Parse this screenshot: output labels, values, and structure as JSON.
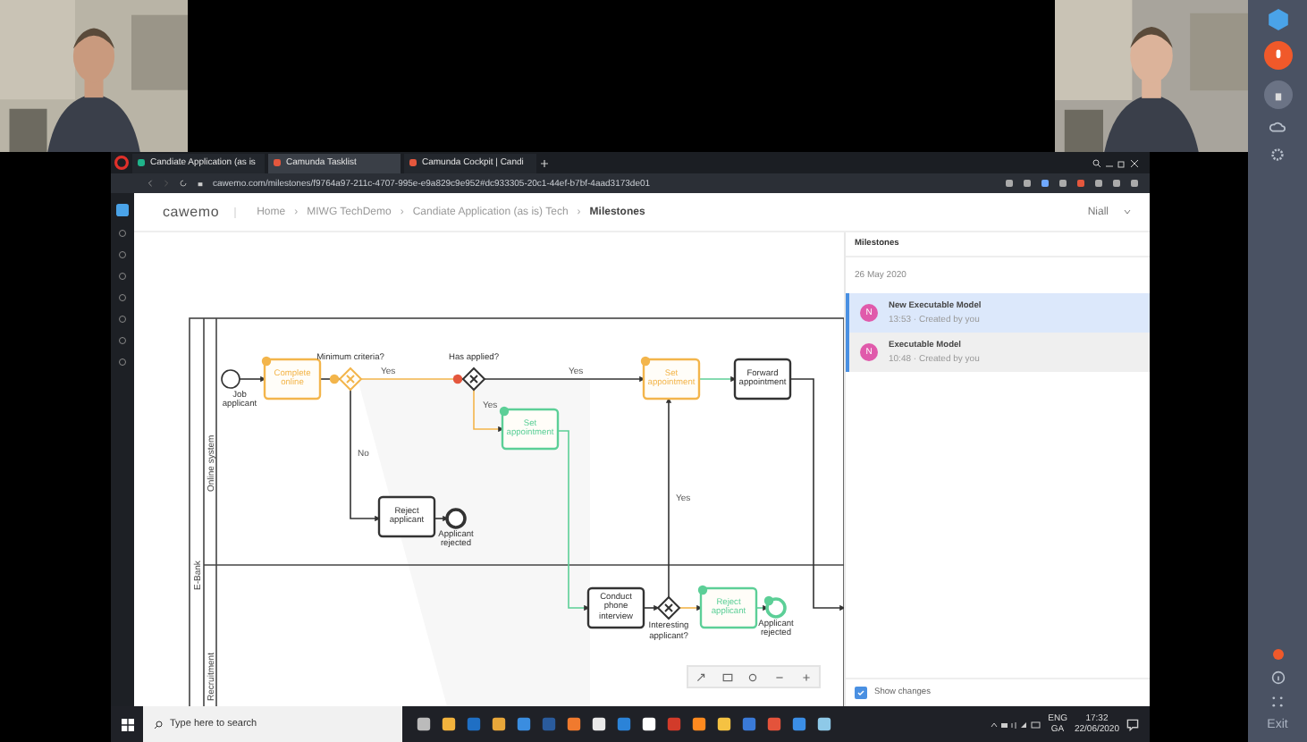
{
  "browser": {
    "tabs": [
      {
        "title": "Candiate Application (as is",
        "selected": false
      },
      {
        "title": "Camunda Tasklist",
        "selected": true
      },
      {
        "title": "Camunda Cockpit | Candi",
        "selected": false
      }
    ],
    "url": "cawemo.com/milestones/f9764a97-211c-4707-995e-e9a829c9e952#dc933305-20c1-44ef-b7bf-4aad3173de01"
  },
  "app": {
    "logo": "cawemo",
    "breadcrumbs": [
      "Home",
      "MIWG TechDemo",
      "Candiate Application (as is) Tech",
      "Milestones"
    ],
    "user": "Niall",
    "separator": "›"
  },
  "diagram": {
    "pool": "E-Bank",
    "lanes": [
      "Online system",
      "Recruitment"
    ],
    "nodes": [
      {
        "kind": "start",
        "label": "Job applicant",
        "color": "#333333",
        "badge": false,
        "incident": false
      },
      {
        "kind": "task",
        "label": "Complete online",
        "color": "#f3b54b",
        "badge": true,
        "incident": false
      },
      {
        "kind": "gateway",
        "label": "Minimum criteria?",
        "color": "#f3b54b",
        "badge": true,
        "incident": false
      },
      {
        "kind": "gateway",
        "label": "Has applied?",
        "color": "#333333",
        "badge": false,
        "incident": true
      },
      {
        "kind": "task",
        "label": "Set appointment",
        "color": "#f3b54b",
        "badge": true,
        "incident": false
      },
      {
        "kind": "task",
        "label": "Forward appointment",
        "color": "#333333",
        "badge": false,
        "incident": false
      },
      {
        "kind": "task",
        "label": "Set appointment",
        "color": "#5ccf97",
        "badge": true,
        "incident": false
      },
      {
        "kind": "task",
        "label": "Reject applicant",
        "color": "#333333",
        "badge": false,
        "incident": false
      },
      {
        "kind": "end",
        "label": "Applicant rejected",
        "color": "#333333",
        "badge": false,
        "incident": false
      },
      {
        "kind": "task",
        "label": "Conduct phone interview",
        "color": "#333333",
        "badge": false,
        "incident": false
      },
      {
        "kind": "gateway",
        "label": "Interesting applicant?",
        "color": "#333333",
        "badge": false,
        "incident": false
      },
      {
        "kind": "task",
        "label": "Reject applicant",
        "color": "#5ccf97",
        "badge": true,
        "incident": false
      },
      {
        "kind": "end",
        "label": "Applicant rejected",
        "color": "#5ccf97",
        "badge": true,
        "incident": false
      }
    ],
    "edge_labels": [
      "Yes",
      "Yes",
      "Yes",
      "No",
      "Yes"
    ]
  },
  "milestones": {
    "title": "Milestones",
    "date": "26 May 2020",
    "items": [
      {
        "avatar": "N",
        "title": "New Executable Model",
        "meta": "13:53 · Created by you",
        "selected": true
      },
      {
        "avatar": "N",
        "title": "Executable Model",
        "meta": "10:48 · Created by you",
        "selected": false
      }
    ],
    "show_changes": {
      "label": "Show changes",
      "checked": true
    }
  },
  "taskbar": {
    "search_placeholder": "Type here to search",
    "language": "ENG",
    "layout": "GA",
    "time": "17:32",
    "date": "22/06/2020"
  },
  "call_sidebar": {
    "exit": "Exit"
  }
}
